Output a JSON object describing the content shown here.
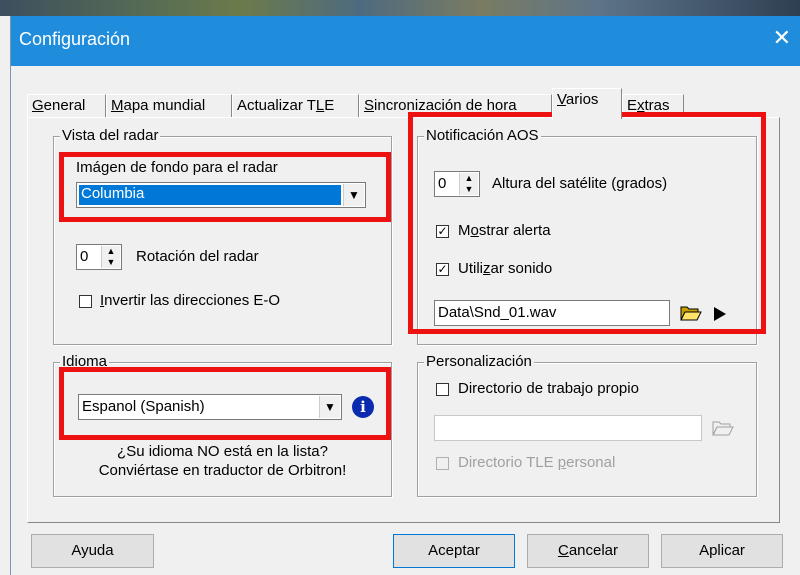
{
  "window": {
    "title": "Configuración"
  },
  "tabs": [
    {
      "label": "General",
      "u": "G",
      "rest": "eneral"
    },
    {
      "label": "Mapa mundial",
      "u": "M",
      "rest": "apa mundial"
    },
    {
      "label": "Actualizar TLE",
      "pre": "Actualizar T",
      "u": "L",
      "rest": "E"
    },
    {
      "label": "Sincronización de hora",
      "u": "S",
      "rest": "incronización de hora"
    },
    {
      "label": "Varios",
      "u": "V",
      "rest": "arios",
      "active": true
    },
    {
      "label": "Extras",
      "pre": "E",
      "u": "x",
      "rest": "tras"
    }
  ],
  "radar": {
    "legend": "Vista del radar",
    "bg_label": "Imágen de fondo para el radar",
    "bg_value": "Columbia",
    "rotation_value": "0",
    "rotation_label": "Rotación del radar",
    "invert_pre": "",
    "invert_u": "I",
    "invert_rest": "nvertir las direcciones E-O",
    "invert_checked": false
  },
  "aos": {
    "legend": "Notificación AOS",
    "altitude_value": "0",
    "altitude_label": "Altura del satélite (grados)",
    "alert_pre": "M",
    "alert_u": "o",
    "alert_rest": "strar alerta",
    "alert_checked": true,
    "sound_pre": "Utili",
    "sound_u": "z",
    "sound_rest": "ar sonido",
    "sound_checked": true,
    "sound_file": "Data\\Snd_01.wav"
  },
  "language": {
    "legend": "Idioma",
    "value": "Espanol (Spanish)",
    "note_line1": "¿Su idioma NO está en la lista?",
    "note_line2": "Conviértase en traductor de Orbitron!"
  },
  "custom": {
    "legend": "Personalización",
    "workdir_label": "Directorio de trabajo propio",
    "workdir_checked": false,
    "workdir_value": "",
    "tle_pre": "Directorio TLE ",
    "tle_u": "p",
    "tle_rest": "ersonal"
  },
  "buttons": {
    "help": "Ayuda",
    "ok": "Aceptar",
    "cancel_u": "C",
    "cancel_rest": "ancelar",
    "apply": "Aplicar"
  },
  "icons": {
    "close": "close-icon",
    "info": "info-icon",
    "folder": "folder-open-icon",
    "play": "play-icon",
    "dropdown": "chevron-down-icon",
    "spinner": "spinner-arrows-icon"
  },
  "colors": {
    "titlebar": "#1f8ddc",
    "selection": "#0078d7",
    "highlight_box": "#ee1111",
    "info": "#0a2bb0"
  }
}
